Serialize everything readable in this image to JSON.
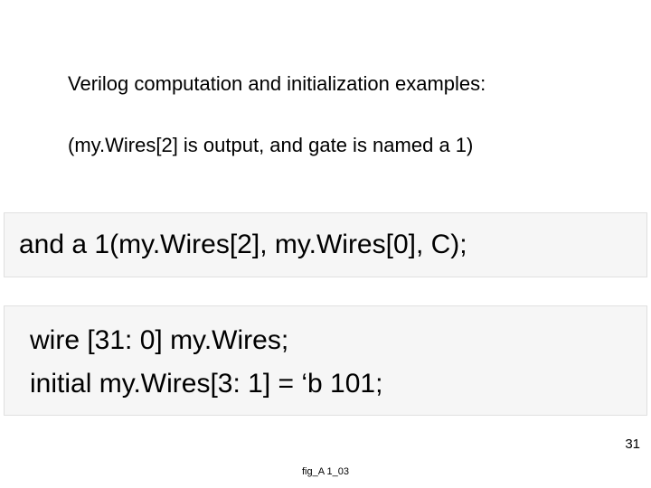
{
  "heading": "Verilog computation and initialization examples:",
  "subheading": "(my.Wires[2] is output, and gate is named a 1)",
  "code1": {
    "line1": "and a 1(my.Wires[2], my.Wires[0], C);"
  },
  "code2": {
    "line1": "wire [31: 0] my.Wires;",
    "line2": "initial my.Wires[3: 1] = ‘b 101;"
  },
  "page_number": "31",
  "footer_label": "fig_A 1_03"
}
